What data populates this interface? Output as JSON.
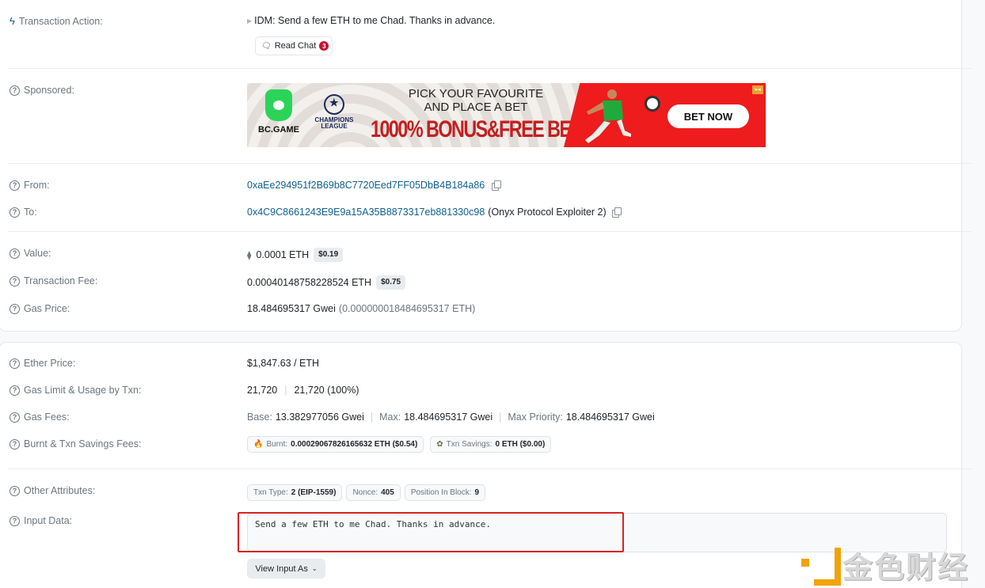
{
  "overview": {
    "transaction_action": {
      "label": "Transaction Action:",
      "text": "IDM: Send a few ETH to me Chad. Thanks in advance.",
      "read_chat_label": "Read Chat",
      "read_chat_count": "3"
    },
    "sponsored": {
      "label": "Sponsored:",
      "ad": {
        "brand": "BC.GAME",
        "league_line1": "CHAMPIONS",
        "league_line2": "LEAGUE",
        "headline1": "PICK YOUR FAVOURITE",
        "headline2": "AND PLACE A BET",
        "promo": "1000% BONUS&FREE BE",
        "cta": "BET NOW",
        "colors": {
          "brand_green": "#2bd459",
          "promo_red": "#c41f1f",
          "panel_red": "#ee1c1c"
        }
      }
    },
    "from": {
      "label": "From:",
      "address": "0xaEe294951f2B69b8C7720Eed7FF05DbB4B184a86"
    },
    "to": {
      "label": "To:",
      "address": "0x4C9C8661243E9E9a15A35B8873317eb881330c98",
      "name_tag": "(Onyx Protocol Exploiter 2)"
    },
    "value": {
      "label": "Value:",
      "amount": "0.0001 ETH",
      "usd": "$0.19"
    },
    "transaction_fee": {
      "label": "Transaction Fee:",
      "amount": "0.00040148758228524 ETH",
      "usd": "$0.75"
    },
    "gas_price": {
      "label": "Gas Price:",
      "gwei": "18.484695317 Gwei",
      "eth": "(0.000000018484695317 ETH)"
    }
  },
  "more_details": {
    "ether_price": {
      "label": "Ether Price:",
      "value": "$1,847.63 / ETH"
    },
    "gas_limit": {
      "label": "Gas Limit & Usage by Txn:",
      "limit": "21,720",
      "usage": "21,720 (100%)"
    },
    "gas_fees": {
      "label": "Gas Fees:",
      "base_label": "Base:",
      "base": "13.382977056 Gwei",
      "max_label": "Max:",
      "max": "18.484695317 Gwei",
      "priority_label": "Max Priority:",
      "priority": "18.484695317 Gwei"
    },
    "burnt_savings": {
      "label": "Burnt & Txn Savings Fees:",
      "burnt_label": "Burnt:",
      "burnt": "0.00029067826165632 ETH ($0.54)",
      "savings_label": "Txn Savings:",
      "savings": "0 ETH ($0.00)"
    },
    "other_attributes": {
      "label": "Other Attributes:",
      "txn_type_label": "Txn Type:",
      "txn_type": "2 (EIP-1559)",
      "nonce_label": "Nonce:",
      "nonce": "405",
      "position_label": "Position In Block:",
      "position": "9"
    },
    "input_data": {
      "label": "Input Data:",
      "value": "Send a few ETH to me Chad. Thanks in advance.",
      "view_as_label": "View Input As"
    }
  },
  "watermark": {
    "text": "金色财经",
    "color": "#f0a30a"
  },
  "colors": {
    "link": "#0d5f8f",
    "highlight": "#d9231f"
  }
}
